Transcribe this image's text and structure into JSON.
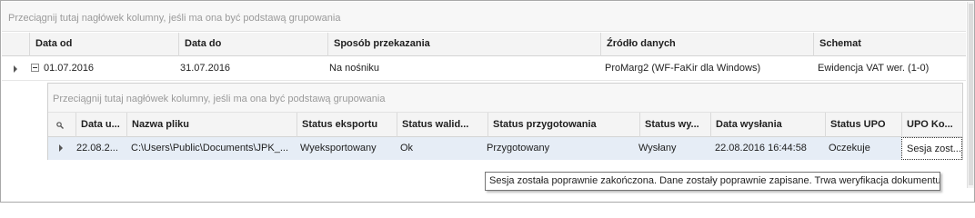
{
  "group_panel": {
    "hint": "Przeciągnij tutaj nagłówek kolumny, jeśli ma ona być podstawą grupowania"
  },
  "master": {
    "columns": [
      "Data od",
      "Data do",
      "Sposób przekazania",
      "Źródło danych",
      "Schemat"
    ],
    "row": {
      "data_od": "01.07.2016",
      "data_do": "31.07.2016",
      "sposob": "Na nośniku",
      "zrodlo": "ProMarg2 (WF-FaKir dla Windows)",
      "schemat": "Ewidencja VAT wer. (1-0)"
    }
  },
  "detail": {
    "group_hint": "Przeciągnij tutaj nagłówek kolumny, jeśli ma ona być podstawą grupowania",
    "columns": [
      "Data u...",
      "Nazwa pliku",
      "Status eksportu",
      "Status walid...",
      "Status przygotowania",
      "Status wy...",
      "Data wysłania",
      "Status UPO",
      "UPO Ko..."
    ],
    "row": {
      "data_u": "22.08.2...",
      "nazwa_pliku": "C:\\Users\\Public\\Documents\\JPK_...",
      "status_eksportu": "Wyeksportowany",
      "status_walidacji": "Ok",
      "status_przygotowania": "Przygotowany",
      "status_wysylki": "Wysłany",
      "data_wyslania": "22.08.2016 16:44:58",
      "status_upo": "Oczekuje",
      "upo_komunikat": "Sesja zost..."
    }
  },
  "tooltip": {
    "text": "Sesja została poprawnie zakończona. Dane zostały poprawnie zapisane. Trwa weryfikacja dokumentu"
  },
  "colors": {
    "selected_row": "#e6edf6",
    "header_bg": "#f4f4f4",
    "border": "#a9a9a9"
  }
}
